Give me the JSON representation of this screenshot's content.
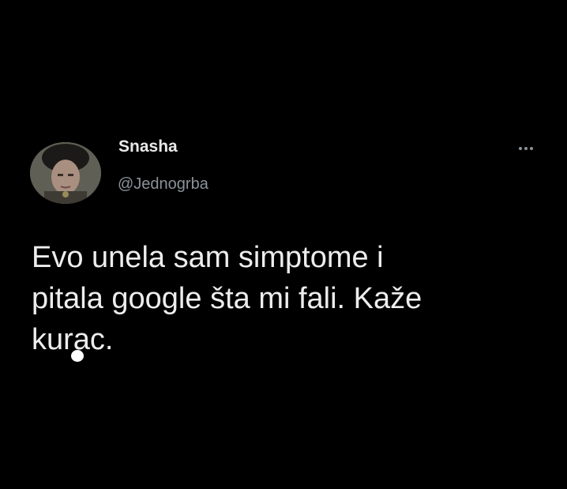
{
  "tweet": {
    "display_name": "Snasha",
    "handle": "@Jednogrba",
    "text_lines": [
      "Evo unela sam simptome i",
      "pitala google šta mi fali. Kaže",
      "kurac."
    ]
  },
  "icons": {
    "avatar": "profile-photo",
    "more": "more-horizontal-icon"
  },
  "colors": {
    "background": "#000000",
    "primary_text": "#e7e9ea",
    "secondary_text": "#8b9299"
  }
}
